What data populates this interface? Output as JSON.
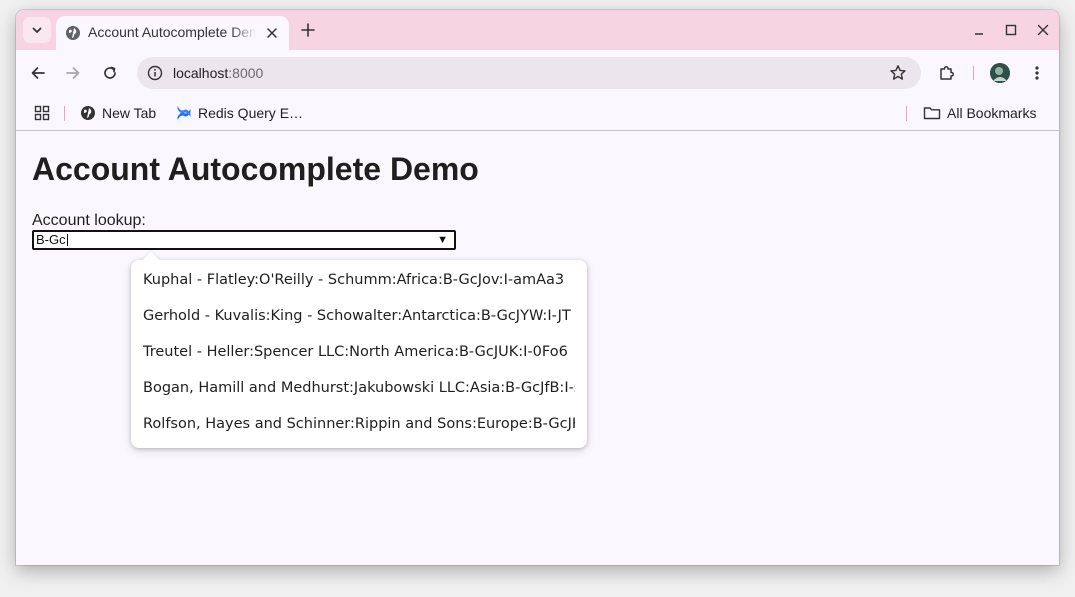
{
  "browser": {
    "tab_title": "Account Autocomplete Demo",
    "url_host": "localhost",
    "url_port": ":8000",
    "bookmarks": [
      {
        "label": "New Tab"
      },
      {
        "label": "Redis Query E…"
      }
    ],
    "all_bookmarks_label": "All Bookmarks"
  },
  "page": {
    "title": "Account Autocomplete Demo",
    "lookup_label": "Account lookup:",
    "lookup_value": "B-Gc",
    "dropdown_arrow": "▼",
    "suggestions": [
      "Kuphal - Flatley:O'Reilly - Schumm:Africa:B-GcJov:I-amAa3",
      "Gerhold - Kuvalis:King - Schowalter:Antarctica:B-GcJYW:I-JT",
      "Treutel - Heller:Spencer LLC:North America:B-GcJUK:I-0Fo6",
      "Bogan, Hamill and Medhurst:Jakubowski LLC:Asia:B-GcJfB:I-s",
      "Rolfson, Hayes and Schinner:Rippin and Sons:Europe:B-GcJKs"
    ]
  }
}
